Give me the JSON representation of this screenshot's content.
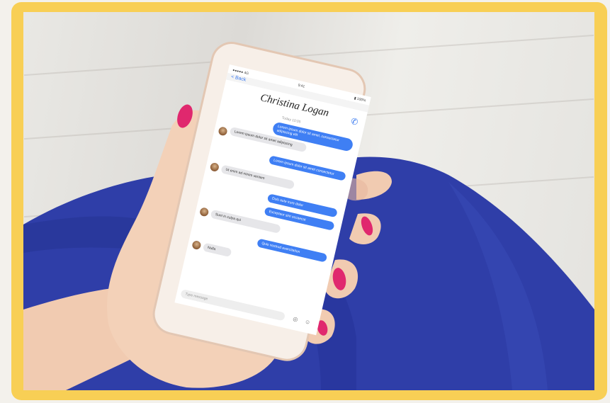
{
  "phone": {
    "status_left": "●●●●● 4G",
    "status_center": "9:41",
    "status_right": "▮ 100%",
    "back_label": "< Back",
    "contact_name": "Christina Logan",
    "date_label": "Today 10:05",
    "input_placeholder": "Type message",
    "icons": {
      "call": "phone-icon",
      "mic": "microphone-icon",
      "emoji": "emoji-icon"
    }
  },
  "messages": [
    {
      "side": "out",
      "text": "Lorem ipsum dolor sit amet, consectetur adipiscing elit"
    },
    {
      "side": "in",
      "text": "Lorem ipsum dolor sit amet adipiscing"
    },
    {
      "side": "out",
      "text": "Lorem ipsum dolor sit amet consectetur"
    },
    {
      "side": "in",
      "text": "Ut enim ad minim veniam"
    },
    {
      "side": "out",
      "text": "Duis aute irure dolor"
    },
    {
      "side": "out",
      "text": "Excepteur sint occaecat"
    },
    {
      "side": "in",
      "text": "Sunt in culpa qui"
    },
    {
      "side": "out",
      "text": "Quis nostrud exercitation"
    },
    {
      "side": "in",
      "text": "Nulla"
    }
  ],
  "colors": {
    "frame": "#f8cf55",
    "bubble_out": "#3f7ff4",
    "bubble_in": "#e6e6e9",
    "skirt": "#2f3ea8",
    "nail": "#e0286e"
  }
}
